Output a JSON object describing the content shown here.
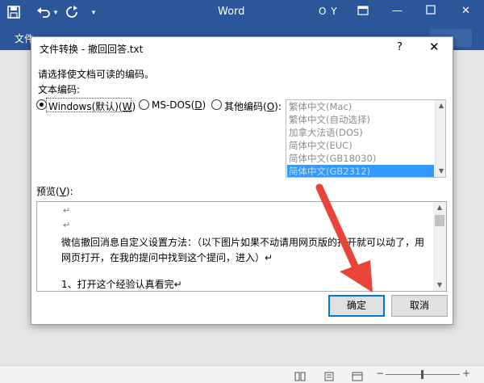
{
  "word": {
    "save_icon": "save-icon",
    "undo_icon": "undo-icon",
    "redo_icon": "redo-icon",
    "customize_icon": "customize-icon",
    "app_title": "Word",
    "user": "O Y",
    "tab_file": "文件"
  },
  "dialog": {
    "title": "文件转换 - 撤回回答.txt",
    "help": "?",
    "close": "✕",
    "instruction": "请选择使文档可读的编码。",
    "encoding_label": "文本编码:",
    "radios": [
      {
        "label": "Windows(默认)(",
        "key": "W",
        "suffix": ")",
        "checked": true
      },
      {
        "label": "MS-DOS(",
        "key": "D",
        "suffix": ")",
        "checked": false
      },
      {
        "label": "其他编码(",
        "key": "O",
        "suffix": "):",
        "checked": false
      }
    ],
    "encodings": [
      "繁体中文(Mac)",
      "繁体中文(自动选择)",
      "加拿大法语(DOS)",
      "简体中文(EUC)",
      "简体中文(GB18030)",
      "简体中文(GB2312)"
    ],
    "selected_encoding": "简体中文(GB2312)",
    "preview_label": "预览(",
    "preview_key": "V",
    "preview_suffix": "):",
    "preview_lines": [
      "微信撤回消息自定义设置方法：（以下图片如果不动请用网页版的打开就可以动了，用",
      "网页打开，在我的提问中找到这个提问，进入）↵",
      "1、打开这个经验认真看完↵"
    ],
    "paragraph_mark": "↵",
    "ok": "确定",
    "cancel": "取消"
  },
  "colors": {
    "word_blue": "#2b579a",
    "selection": "#3399ff",
    "pointer_arrow": "#e8443a"
  }
}
